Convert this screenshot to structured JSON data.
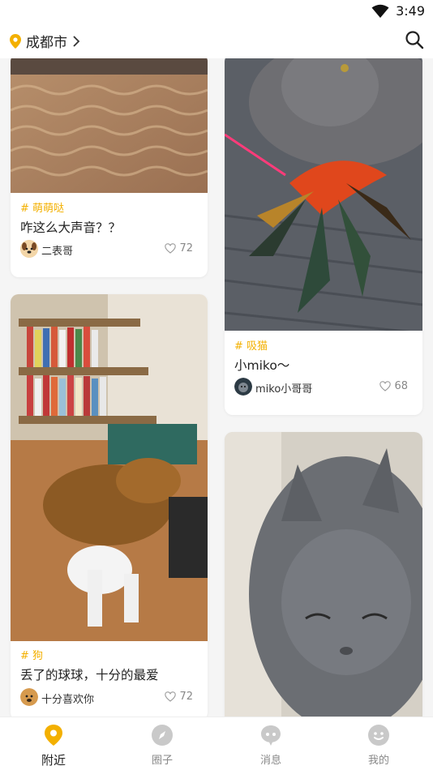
{
  "status": {
    "time": "3:49"
  },
  "header": {
    "city": "成都市"
  },
  "feed": {
    "left": [
      {
        "tag": "# 萌萌哒",
        "title": "咋这么大声音？？",
        "author": "二表哥",
        "likes": "72"
      },
      {
        "tag": "# 狗",
        "title": "丢了的球球，十分的最爱",
        "author": "十分喜欢你",
        "likes": "72"
      }
    ],
    "right": [
      {
        "tag": "# 吸猫",
        "title": "小miko～",
        "author": "miko小哥哥",
        "likes": "68"
      }
    ]
  },
  "tabs": [
    {
      "label": "附近"
    },
    {
      "label": "圈子"
    },
    {
      "label": "消息"
    },
    {
      "label": "我的"
    }
  ],
  "colors": {
    "accent": "#f3b000",
    "tab_inactive": "#c9c9c9"
  }
}
